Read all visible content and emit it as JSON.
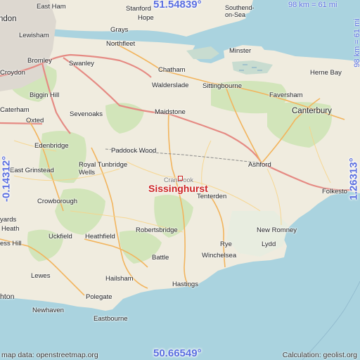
{
  "map": {
    "target_label": "Sissinghurst",
    "coords": {
      "top": "51.54839°",
      "bottom": "50.66549°",
      "left": "-0.14312°",
      "right": "1.26313°"
    },
    "scale_top": "98 km = 61 mi",
    "scale_right": "98 km = 61 mi",
    "attribution": "map data: openstreetmap.org",
    "calculation": "Calculation: geolist.org",
    "colors": {
      "sea": "#aad3df",
      "land": "#f0ecdf",
      "forest": "#cde4b4",
      "road_major": "#f2b45d",
      "road_minor": "#f7d48a",
      "motorway": "#e58a83",
      "coord_text": "#5a6ee0",
      "target_text": "#cc2222"
    }
  },
  "places": {
    "london": "ndon",
    "east_ham": "East Ham",
    "stanford": "Stanford",
    "le_hope": "Hope",
    "southend": "Southend-\non-Sea",
    "lewisham": "Lewisham",
    "grays": "Grays",
    "croydon": "Croydon",
    "bromley": "Bromley",
    "northfleet": "Northfleet",
    "swanley": "Swanley",
    "minster": "Minster",
    "herne_bay": "Herne Bay",
    "chatham": "Chatham",
    "walderslade": "Walderslade",
    "sittingbourne": "Sittingbourne",
    "faversham": "Faversham",
    "biggin_hill": "Biggin Hill",
    "caterham": "Caterham",
    "sevenoaks": "Sevenoaks",
    "maidstone": "Maidstone",
    "canterbury": "Canterbury",
    "oxted": "Oxted",
    "edenbridge": "Edenbridge",
    "paddock_wood": "Paddock Wood",
    "ashford": "Ashford",
    "east_grinstead": "East Grinstead",
    "royal_tunbridge_wells": "Royal Tunbridge\nWells",
    "cranbrook": "Cranbrook",
    "folkestone": "Folkesto",
    "tenterden": "Tenterden",
    "crowborough": "Crowborough",
    "haywards": "yards",
    "heath": "Heath",
    "uckfield": "Uckfield",
    "heathfield": "Heathfield",
    "robertsbridge": "Robertsbridge",
    "new_romney": "New Romney",
    "burgess_hill": "ess Hill",
    "rye": "Rye",
    "lydd": "Lydd",
    "winchelsea": "Winchelsea",
    "battle": "Battle",
    "lewes": "Lewes",
    "hailsham": "Hailsham",
    "hastings": "Hastings",
    "brighton": "hton",
    "polegate": "Polegate",
    "newhaven": "Newhaven",
    "eastbourne": "Eastbourne"
  }
}
